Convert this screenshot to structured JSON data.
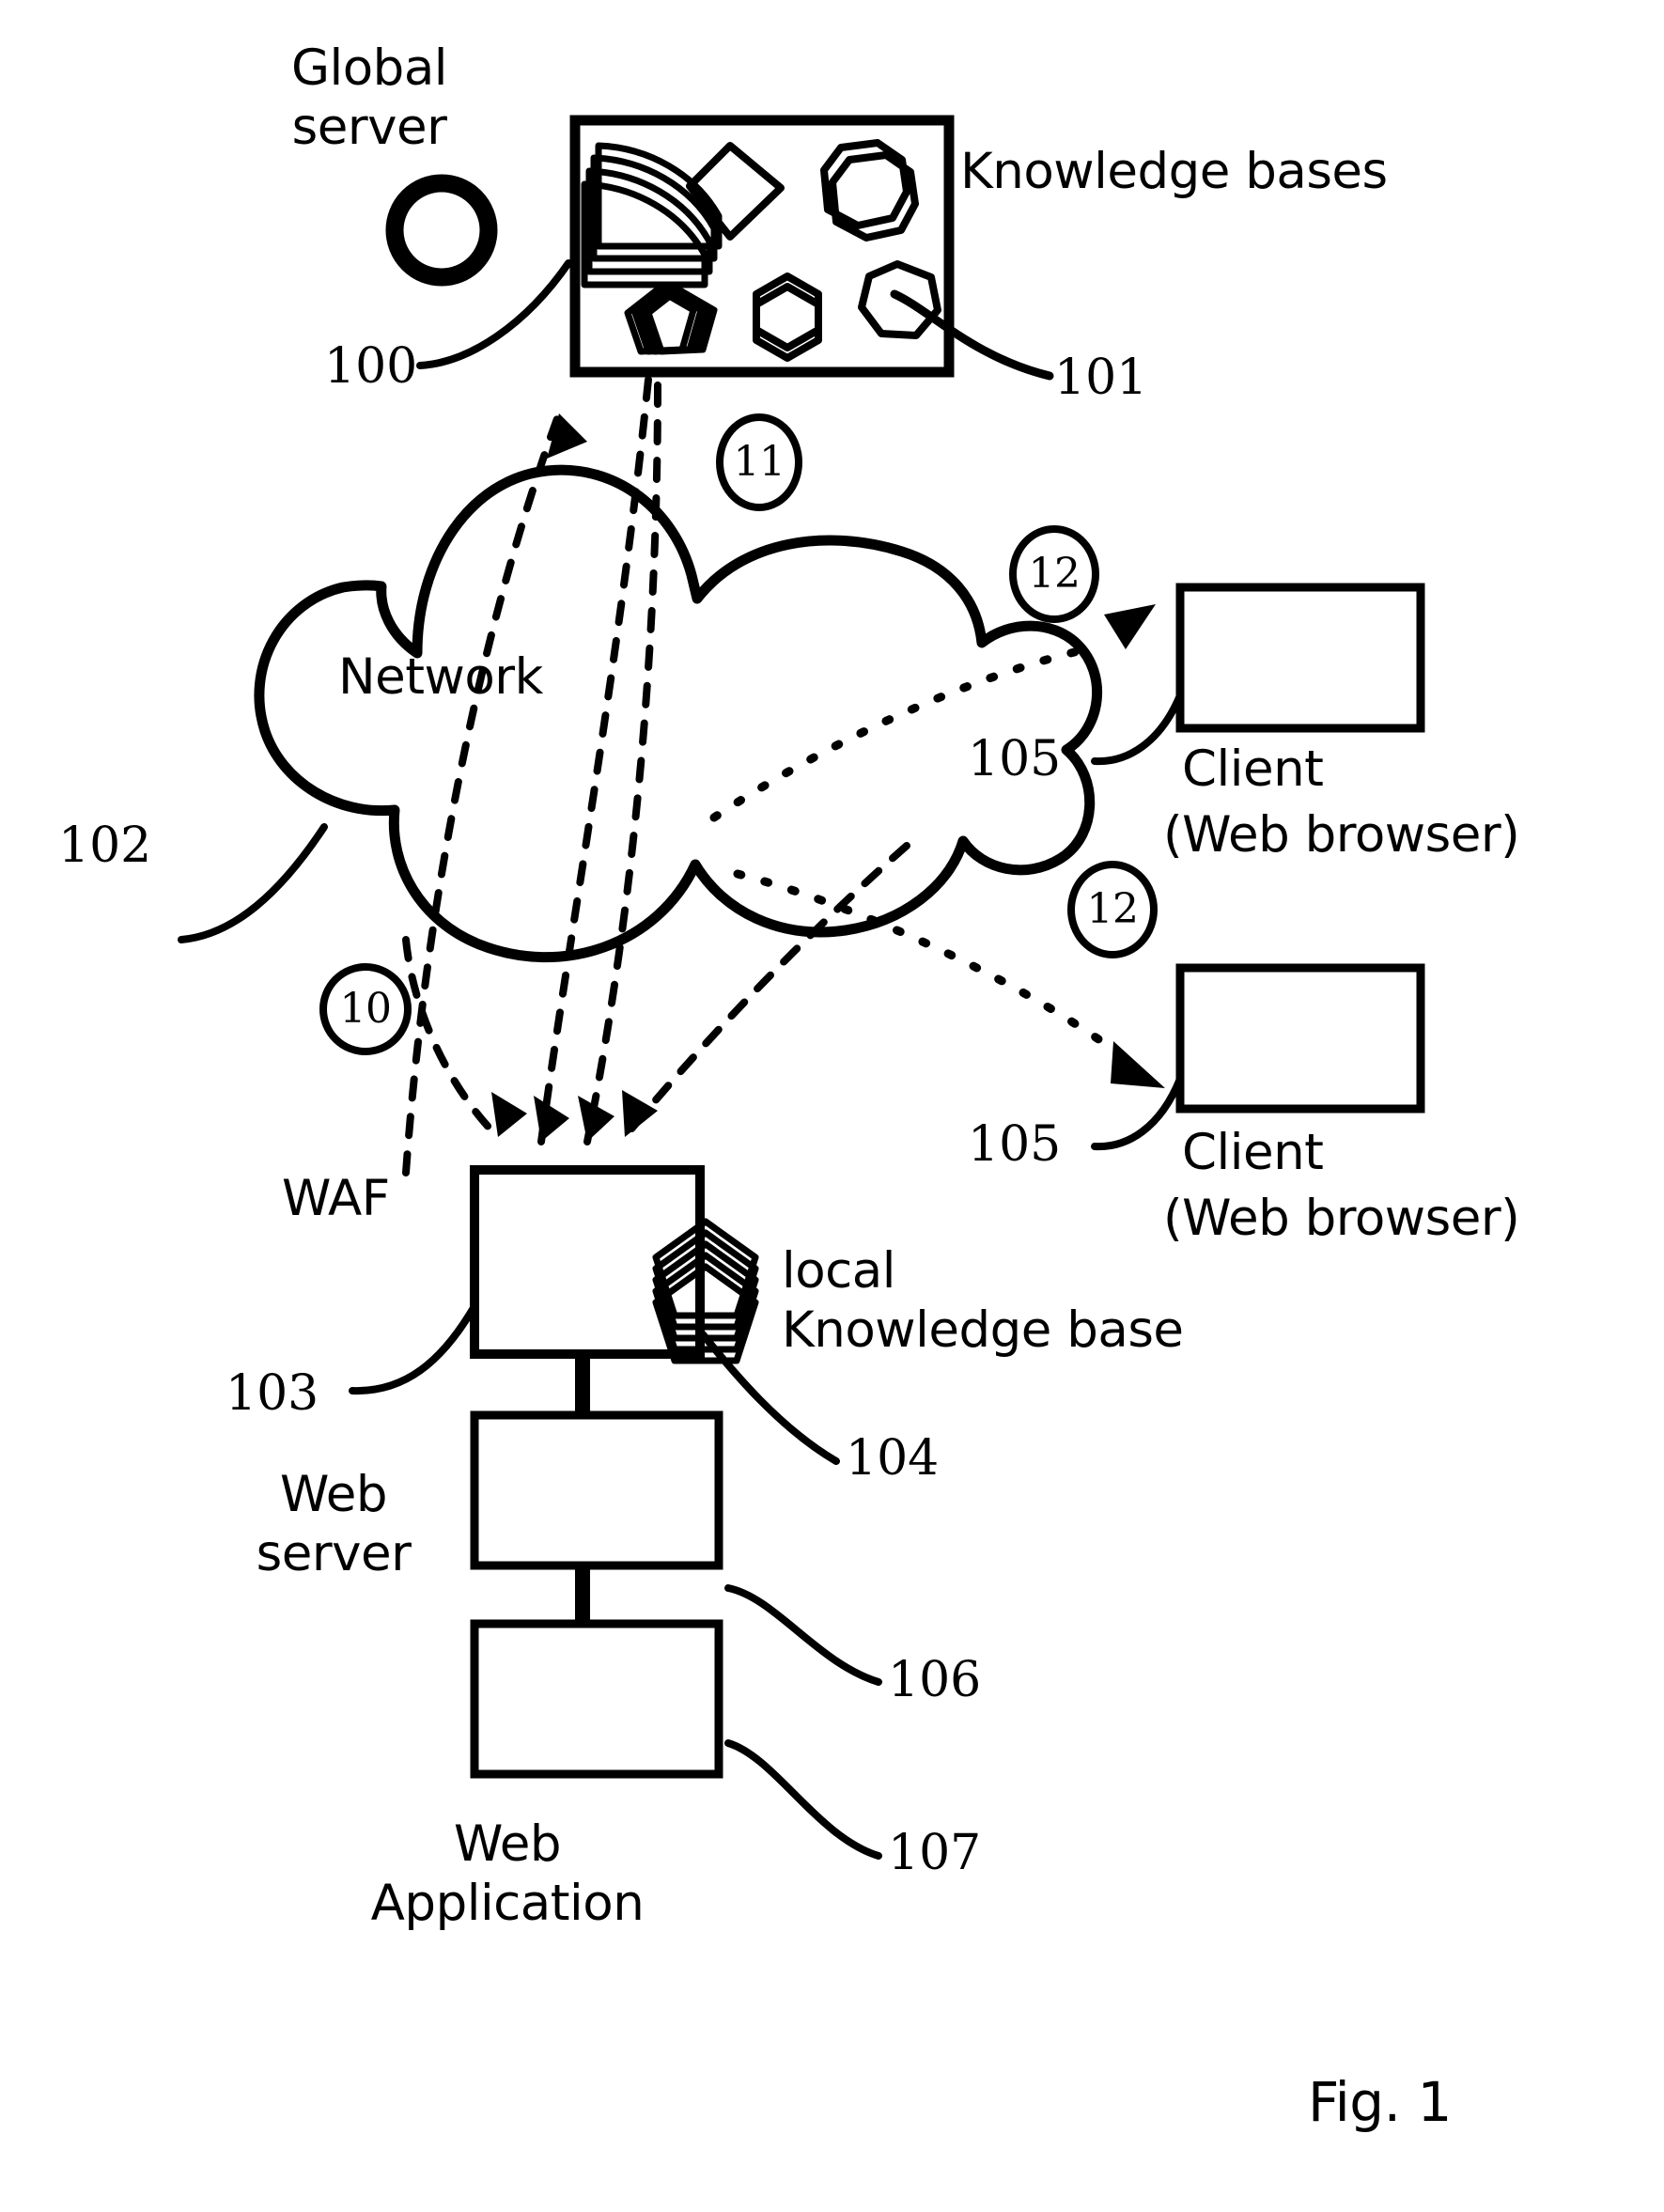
{
  "figure": {
    "caption": "Fig. 1",
    "title_labels": {
      "global_server": "Global\nserver",
      "knowledge_bases": "Knowledge bases",
      "network": "Network",
      "waf": "WAF",
      "local_knowledge_base": "local\nKnowledge base",
      "web_server": "Web\nserver",
      "web_application": "Web\nApplication",
      "client_1_line1": "Client",
      "client_1_line2": "(Web browser)",
      "client_2_line1": "Client",
      "client_2_line2": "(Web browser)"
    },
    "reference_numerals": {
      "global_server": "100",
      "knowledge_bases": "101",
      "network": "102",
      "waf": "103",
      "local_knowledge_base": "104",
      "client_1": "105",
      "client_2": "105",
      "web_server": "106",
      "web_application": "107"
    },
    "circled_step_numbers": {
      "step_to_waf": "10",
      "step_global_to_network": "11",
      "step_client_1": "12",
      "step_client_2": "12"
    },
    "colors": {
      "line": "#000000",
      "background": "#ffffff"
    }
  }
}
